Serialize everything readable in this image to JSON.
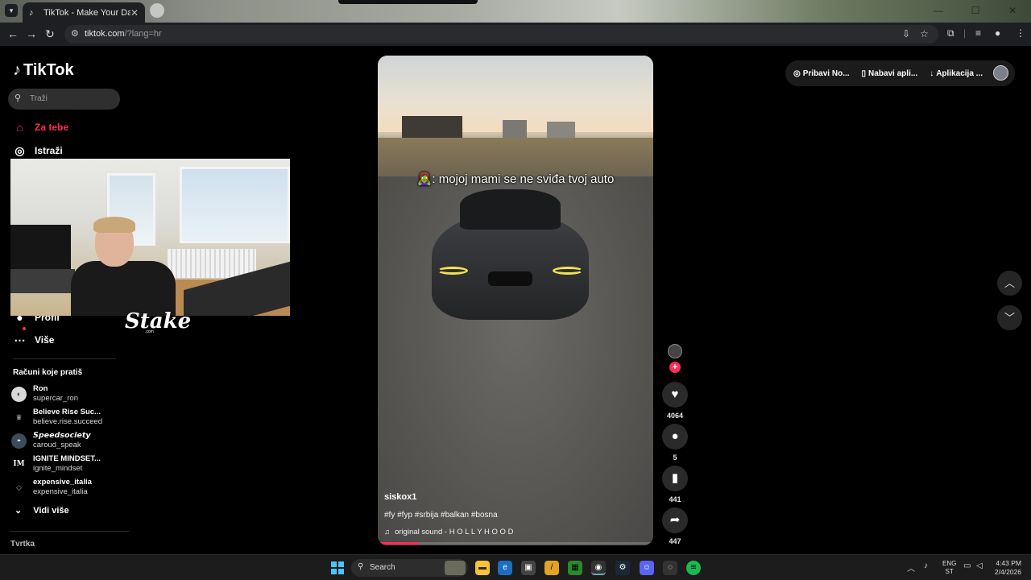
{
  "browser": {
    "tab_title": "TikTok - Make Your Day",
    "url_host": "tiktok.com",
    "url_path": "/?lang=hr"
  },
  "sidebar": {
    "logo_text": "TikTok",
    "search_placeholder": "Traži",
    "nav": [
      {
        "label": "Za tebe",
        "icon": "home-icon",
        "active": true
      },
      {
        "label": "Istraži",
        "icon": "compass-icon"
      },
      {
        "label": "Profil",
        "icon": "profile-icon"
      },
      {
        "label": "Više",
        "icon": "more-icon"
      }
    ],
    "following_header": "Računi koje pratiš",
    "accounts": [
      {
        "name": "Ron",
        "handle": "supercar_ron"
      },
      {
        "name": "Believe Rise Suc...",
        "handle": "believe.rise.succeed"
      },
      {
        "name": "𝙎𝙥𝙚𝙚𝙙𝙨𝙤𝙘𝙞𝙚𝙩𝙮",
        "handle": "caroud_speak"
      },
      {
        "name": "IGNITE MINDSET...",
        "handle": "ignite_mindset"
      },
      {
        "name": "expensive_italia",
        "handle": "expensive_italia"
      }
    ],
    "see_more": "Vidi više",
    "company": "Tvrtka"
  },
  "overlay": {
    "brand": "Stake",
    "brand_sub": ".com"
  },
  "video": {
    "caption": "🧟‍♀️: mojoj mami se ne sviđa tvoj auto",
    "username": "siskox1",
    "hashtags": "#fy #fyp #srbija #balkan #bosna",
    "sound": "original sound - H O L L Y H O O D",
    "progress": 0.15
  },
  "actions": {
    "likes": "4064",
    "comments": "5",
    "saves": "441",
    "shares": "447"
  },
  "topbar": {
    "items": [
      "Pribavi No...",
      "Nabavi apli...",
      "Aplikacija ..."
    ]
  },
  "taskbar": {
    "search": "Search",
    "lang_top": "ENG",
    "lang_bottom": "ST",
    "time": "4:43 PM",
    "date": "2/4/2026"
  },
  "colors": {
    "accent": "#fe2c55",
    "background": "#000000"
  }
}
